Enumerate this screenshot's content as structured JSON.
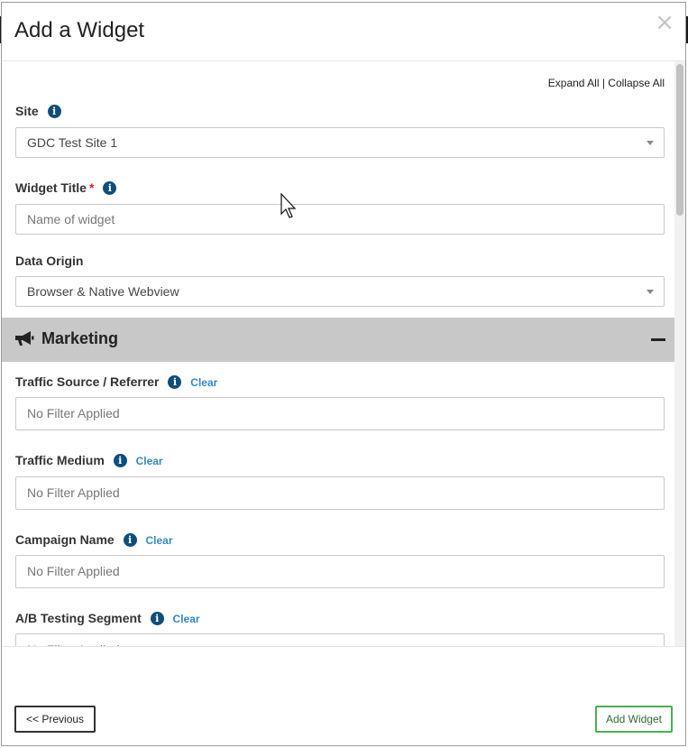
{
  "modal": {
    "title": "Add a Widget",
    "close_glyph": "×"
  },
  "links": {
    "expand_all": "Expand All",
    "separator": " | ",
    "collapse_all": "Collapse All"
  },
  "fields": {
    "site": {
      "label": "Site",
      "value": "GDC Test Site 1"
    },
    "widget_title": {
      "label": "Widget Title",
      "required_mark": "*",
      "placeholder": "Name of widget"
    },
    "data_origin": {
      "label": "Data Origin",
      "value": "Browser & Native Webview"
    }
  },
  "marketing": {
    "title": "Marketing",
    "clear_label": "Clear",
    "filters": [
      {
        "label": "Traffic Source / Referrer",
        "placeholder": "No Filter Applied"
      },
      {
        "label": "Traffic Medium",
        "placeholder": "No Filter Applied"
      },
      {
        "label": "Campaign Name",
        "placeholder": "No Filter Applied"
      },
      {
        "label": "A/B Testing Segment",
        "placeholder": "No Filter Applied"
      }
    ]
  },
  "footer": {
    "previous_label": "<< Previous",
    "add_label": "Add Widget"
  },
  "icons": {
    "info": "i",
    "section": "megaphone-icon"
  },
  "colors": {
    "info_icon": "#0f4d7a",
    "link": "#3289c8",
    "required": "#d9232d",
    "add_button_border": "#4caf50",
    "section_bar": "#c8c8c8"
  }
}
